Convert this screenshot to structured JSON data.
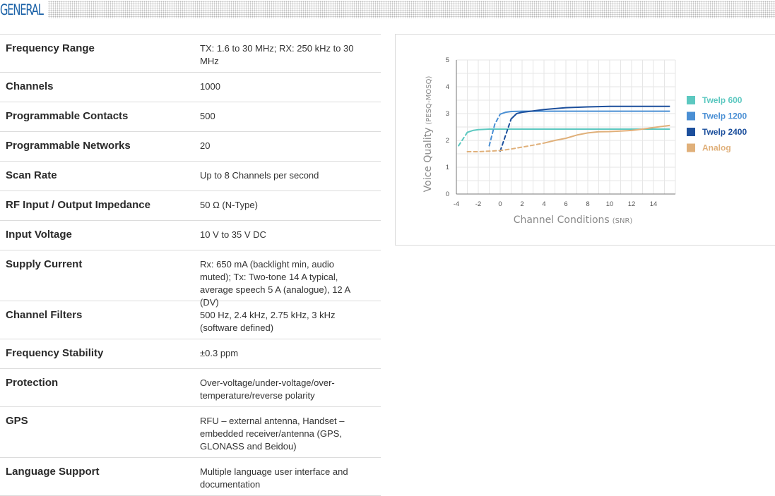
{
  "section": {
    "title": "GENERAL"
  },
  "specs": [
    {
      "label": "Frequency Range",
      "value": "TX: 1.6 to 30 MHz; RX: 250 kHz to 30 MHz"
    },
    {
      "label": "Channels",
      "value": "1000"
    },
    {
      "label": "Programmable Contacts",
      "value": "500"
    },
    {
      "label": "Programmable Networks",
      "value": "20"
    },
    {
      "label": "Scan Rate",
      "value": "Up to 8 Channels per second"
    },
    {
      "label": "RF Input / Output Impedance",
      "value": "50 Ω (N-Type)"
    },
    {
      "label": "Input Voltage",
      "value": "10 V to 35 V DC"
    },
    {
      "label": "Supply Current",
      "value": "Rx: 650 mA (backlight min, audio muted); Tx: Two-tone 14 A typical, average speech 5 A (analogue), 12 A (DV)"
    },
    {
      "label": "Channel Filters",
      "value": "500 Hz, 2.4 kHz, 2.75 kHz, 3 kHz (software defined)"
    },
    {
      "label": "Frequency Stability",
      "value": "±0.3 ppm"
    },
    {
      "label": "Protection",
      "value": "Over-voltage/under-voltage/over-temperature/reverse polarity"
    },
    {
      "label": "GPS",
      "value": "RFU – external antenna, Handset – embedded receiver/antenna (GPS, GLONASS and Beidou)"
    },
    {
      "label": "Language Support",
      "value": "Multiple language user interface and documentation"
    }
  ],
  "chart_data": {
    "type": "line",
    "xlabel": "Channel Conditions",
    "xlabel_unit": "(SNR)",
    "ylabel": "Voice Quality",
    "ylabel_unit": "(PESQ-MOSQ)",
    "xlim": [
      -4,
      16
    ],
    "ylim": [
      0,
      5
    ],
    "xticks": [
      -4,
      -2,
      0,
      2,
      4,
      6,
      8,
      10,
      12,
      14
    ],
    "yticks": [
      0,
      1,
      2,
      3,
      4,
      5
    ],
    "grid": true,
    "legend_position": "right",
    "series": [
      {
        "name": "Twelp 600",
        "color": "#5cc8c0",
        "dashed_x": [
          -3.8,
          -3.0
        ],
        "dashed_y": [
          1.8,
          2.3
        ],
        "x": [
          -3.0,
          -2.5,
          -2,
          -1,
          0,
          2,
          4,
          6,
          8,
          10,
          12,
          14,
          15.5
        ],
        "y": [
          2.3,
          2.37,
          2.4,
          2.42,
          2.42,
          2.42,
          2.42,
          2.42,
          2.42,
          2.42,
          2.42,
          2.42,
          2.42
        ]
      },
      {
        "name": "Twelp 1200",
        "color": "#4a8fd4",
        "dashed_x": [
          -1.0,
          -0.5,
          0.0
        ],
        "dashed_y": [
          1.8,
          2.6,
          2.98
        ],
        "x": [
          0.0,
          0.5,
          1,
          2,
          4,
          6,
          8,
          10,
          12,
          14,
          15.5
        ],
        "y": [
          2.98,
          3.05,
          3.08,
          3.09,
          3.09,
          3.09,
          3.09,
          3.09,
          3.09,
          3.09,
          3.09
        ]
      },
      {
        "name": "Twelp 2400",
        "color": "#1c4f9c",
        "dashed_x": [
          0.0,
          0.5,
          1.0
        ],
        "dashed_y": [
          1.6,
          2.2,
          2.8
        ],
        "x": [
          1.0,
          1.5,
          2,
          3,
          4,
          6,
          8,
          10,
          12,
          14,
          15.5
        ],
        "y": [
          2.8,
          3.0,
          3.05,
          3.1,
          3.15,
          3.22,
          3.25,
          3.27,
          3.27,
          3.27,
          3.27
        ]
      },
      {
        "name": "Analog",
        "color": "#e0b07a",
        "dashed_x": [
          -3,
          -2,
          -1,
          0,
          1,
          2,
          3,
          4
        ],
        "dashed_y": [
          1.58,
          1.58,
          1.6,
          1.62,
          1.68,
          1.75,
          1.82,
          1.9
        ],
        "x": [
          4,
          5,
          6,
          7,
          8,
          9,
          10,
          11,
          12,
          13,
          14,
          15.5
        ],
        "y": [
          1.9,
          2.0,
          2.08,
          2.2,
          2.28,
          2.32,
          2.33,
          2.35,
          2.37,
          2.42,
          2.48,
          2.56
        ]
      }
    ]
  }
}
